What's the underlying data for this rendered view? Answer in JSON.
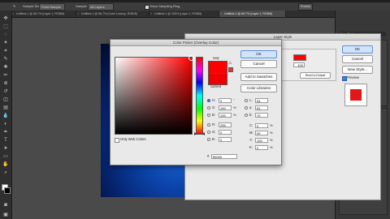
{
  "options_bar": {
    "sample_size_label": "Sample Size:",
    "sample_size_value": "Point Sample",
    "sample_label": "Sample:",
    "sample_value": "All Layers",
    "show_ring_label": "Show Sampling Ring"
  },
  "tabs": [
    {
      "label": "Untitled-1 @ 66.7% (Layer 1, RGB/8)"
    },
    {
      "label": "Untitled-1 @ 66.7% (Color Lookup, RGB/8)"
    },
    {
      "label": "Untitled-1 @ 100% (Layer 1, RGB/8)"
    },
    {
      "label": "Untitled-1 @ 66.7% (Layer 1, RGB/8)"
    }
  ],
  "topright_button": "Presets",
  "layer_style": {
    "title": "Layer Style",
    "ok": "OK",
    "cancel": "Cancel",
    "new_style": "New Style...",
    "preview": "Preview",
    "preview_checked": true,
    "fx_value": "100",
    "reset_label": "Reset to Default"
  },
  "right_panel": {
    "tab_label": "Layers",
    "side_label": "New Badge"
  },
  "color_picker": {
    "title": "Color Picker (Overlay Color)",
    "new_label": "new",
    "current_label": "current",
    "ok": "OK",
    "cancel": "Cancel",
    "add_to_swatches": "Add to Swatches",
    "color_libraries": "Color Libraries",
    "only_web_colors": "Only Web Colors",
    "hex_label": "#",
    "hex_value": "ff0000",
    "colors": {
      "new": "#ff0000",
      "current": "#ee0000",
      "accent": "#3d7ddb"
    },
    "hsb": [
      {
        "label": "H:",
        "value": "0",
        "unit": "°",
        "selected": true
      },
      {
        "label": "S:",
        "value": "100",
        "unit": "%",
        "selected": false
      },
      {
        "label": "B:",
        "value": "100",
        "unit": "%",
        "selected": false
      }
    ],
    "rgb": [
      {
        "label": "R:",
        "value": "255"
      },
      {
        "label": "G:",
        "value": "0"
      },
      {
        "label": "B:",
        "value": "0"
      }
    ],
    "lab": [
      {
        "label": "L:",
        "value": "54"
      },
      {
        "label": "a:",
        "value": "81"
      },
      {
        "label": "b:",
        "value": "70"
      }
    ],
    "cmyk": [
      {
        "label": "C:",
        "value": "0",
        "unit": "%"
      },
      {
        "label": "M:",
        "value": "99",
        "unit": "%"
      },
      {
        "label": "Y:",
        "value": "100",
        "unit": "%"
      },
      {
        "label": "K:",
        "value": "0",
        "unit": "%"
      }
    ]
  }
}
